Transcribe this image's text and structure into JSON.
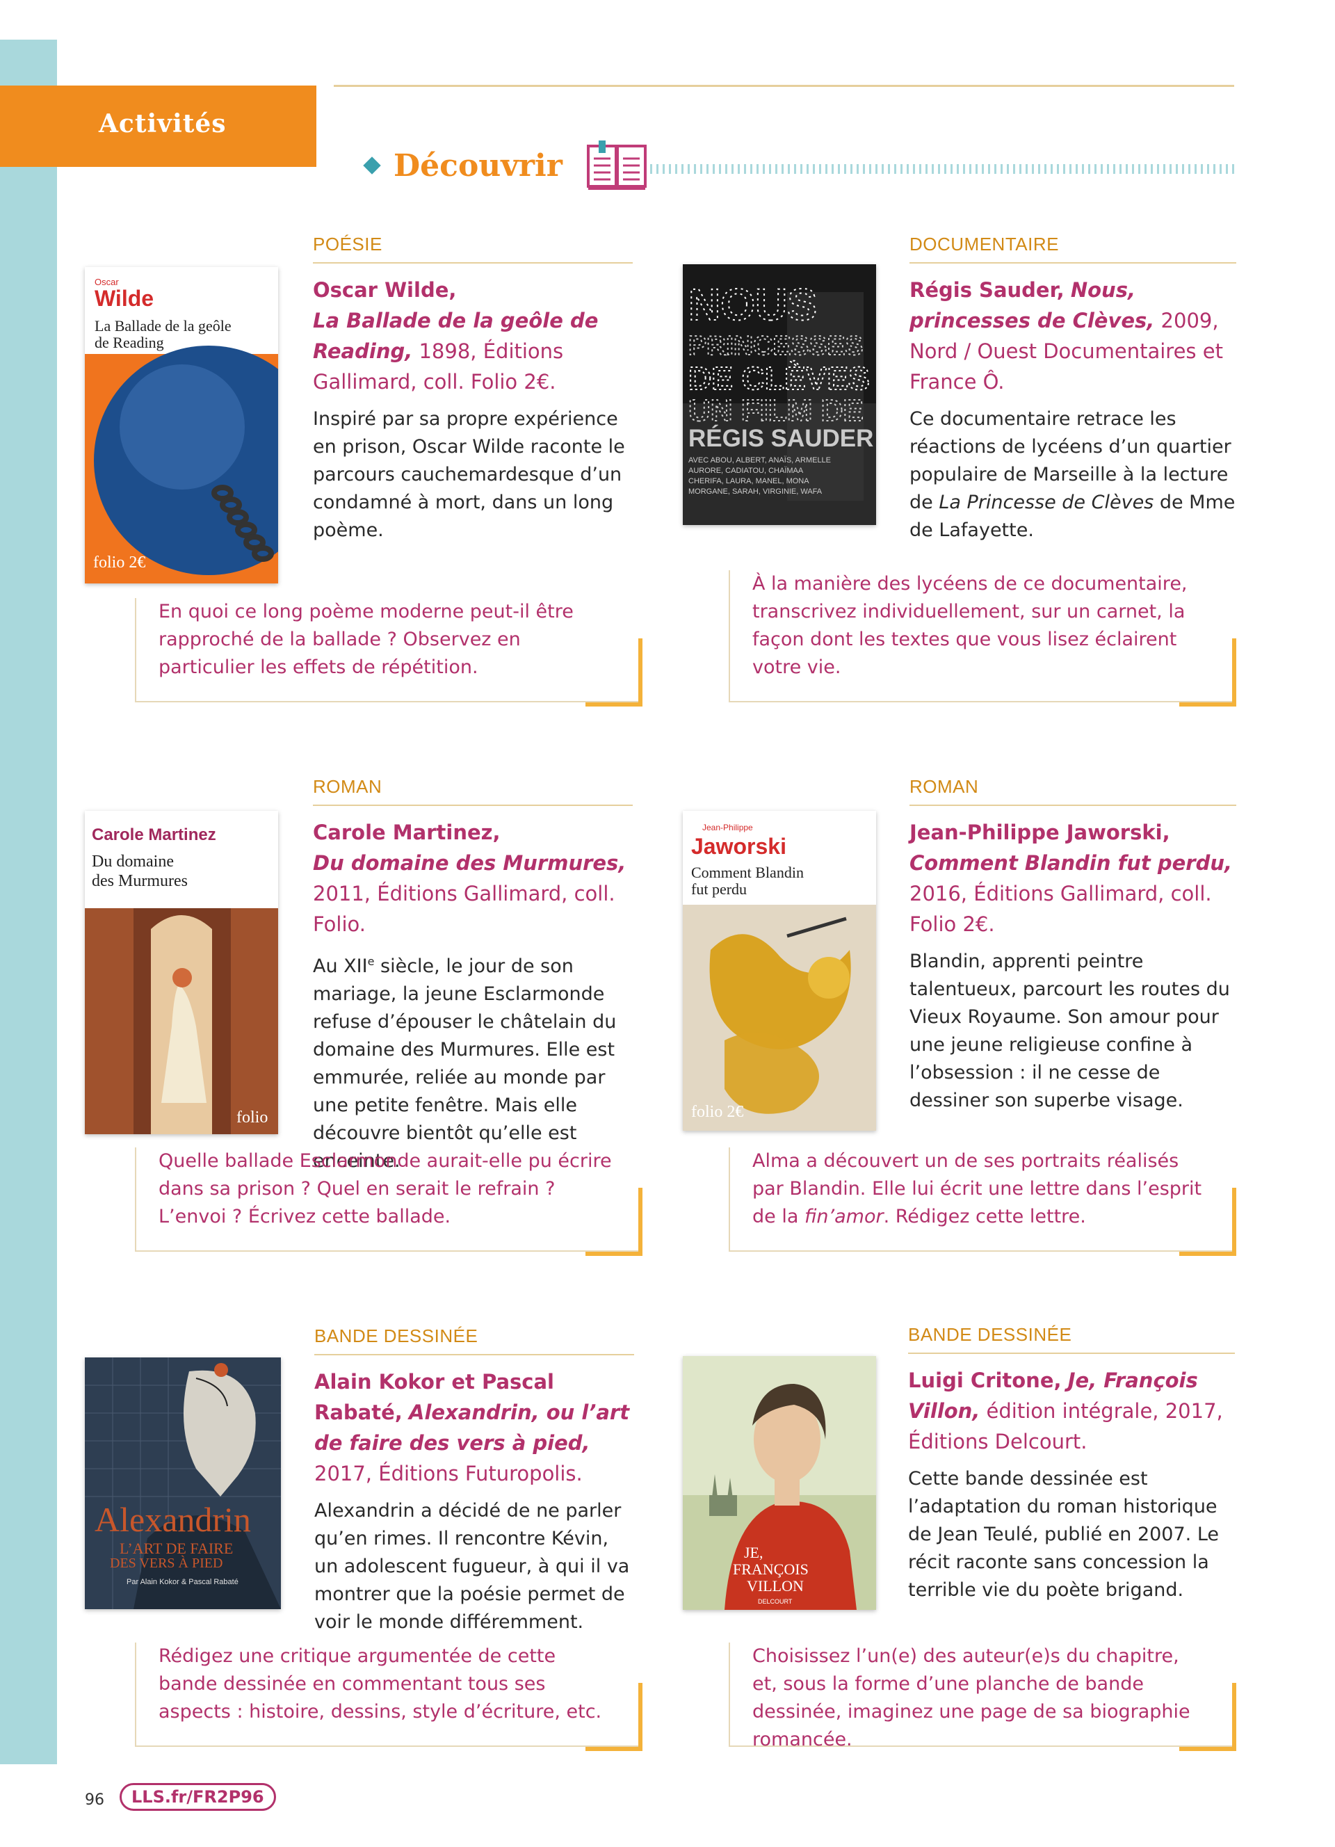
{
  "header": {
    "tab_label": "Activités",
    "section_title": "Découvrir"
  },
  "works": [
    {
      "category": "POÉSIE",
      "author": "Oscar Wilde,",
      "title": "La Ballade de la geôle de Reading,",
      "details": " 1898, Éditions Gallimard, coll. Folio 2€.",
      "description": "Inspiré par sa propre expérience en prison, Oscar Wilde raconte le parcours cauchemardesque d’un condamné à mort, dans un long poème.",
      "question": "En quoi ce long poème moderne peut-il être rapproché de la ballade ? Observez en particulier les effets de répétition.",
      "cover": {
        "small": "Oscar",
        "author": "Wilde",
        "title": "La Ballade de la geôle de Reading",
        "imprint": "folio 2€"
      }
    },
    {
      "category": "DOCUMENTAIRE",
      "author": "Régis Sauder,",
      "title": "Nous, princesses de Clèves,",
      "details": " 2009, Nord / Ouest Documentaires et France Ô.",
      "desc_pre": "Ce documentaire retrace les réactions de lycéens d’un quartier populaire de Marseille à la lecture de ",
      "desc_italic": "La Princesse de Clèves",
      "desc_post": " de Mme de Lafayette.",
      "question": "À la manière des lycéens de ce documentaire, transcrivez individuellement, sur un carnet, la façon dont les textes que vous lisez éclairent votre vie.",
      "cover": {
        "line1": "NOUS",
        "line2": "PRINCESSES",
        "line3": "DE CLÈVES",
        "line4": "UN FILM DE",
        "line5": "RÉGIS SAUDER",
        "cast": "AVEC ABOU, ALBERT, ANAÏS, ARMELLE AURORE, CADIATOU, CHAÏMAA, CHERIFA, LAURA, MANEL, MONA MORGANE, SARAH, VIRGINIE, WAFA"
      }
    },
    {
      "category": "ROMAN",
      "author": "Carole Martinez,",
      "title": "Du domaine des Murmures,",
      "details": " 2011, Éditions Gallimard, coll. Folio.",
      "desc_pre": "Au XII",
      "desc_sup": "e",
      "desc_post": " siècle, le jour de son mariage, la jeune Esclarmonde refuse d’épouser le châtelain du domaine des Murmures. Elle est emmurée, reliée au monde par une petite fenêtre. Mais elle découvre bientôt qu’elle est enceinte.",
      "question": "Quelle ballade Esclarmonde aurait-elle pu écrire dans sa prison ? Quel en serait le refrain ? L’envoi ? Écrivez cette ballade.",
      "cover": {
        "author": "Carole Martinez",
        "title": "Du domaine des Murmures",
        "imprint": "folio"
      }
    },
    {
      "category": "ROMAN",
      "author": "Jean-Philippe Jaworski,",
      "title": "Comment Blandin fut perdu,",
      "details": " 2016, Éditions Gallimard, coll. Folio 2€.",
      "description": "Blandin, apprenti peintre talentueux, parcourt les routes du Vieux Royaume. Son amour pour une jeune religieuse confine à l’obsession : il ne cesse de dessiner son superbe visage.",
      "q_pre": "Alma a découvert un de ses portraits réalisés par Blandin. Elle lui écrit une lettre dans l’esprit de la ",
      "q_italic": "fin’amor",
      "q_post": ". Rédigez cette lettre.",
      "cover": {
        "small": "Jean-Philippe",
        "author": "Jaworski",
        "title": "Comment Blandin fut perdu",
        "imprint": "folio 2€"
      }
    },
    {
      "category": "BANDE DESSINÉE",
      "author": "Alain Kokor et Pascal Rabaté,",
      "title": "Alexandrin, ou l’art de faire des vers à pied,",
      "details": " 2017, Éditions Futuropolis.",
      "description": "Alexandrin a décidé de ne parler qu’en rimes. Il rencontre Kévin, un adolescent fugueur, à qui il va montrer que la poésie permet de voir le monde différemment.",
      "question": "Rédigez une critique argumentée de cette bande dessinée en commentant tous ses aspects : histoire, dessins, style d’écriture, etc.",
      "cover": {
        "title": "Alexandrin",
        "subtitle": "L’ART DE FAIRE DES VERS À PIED",
        "by": "Par Alain Kokor & Pascal Rabaté"
      }
    },
    {
      "category": "BANDE DESSINÉE",
      "author": "Luigi Critone,",
      "title": "Je, François Villon,",
      "details": " édition intégrale, 2017, Éditions Delcourt.",
      "description": "Cette bande dessinée est l’adaptation du roman historique de Jean Teulé, publié en 2007. Le récit raconte sans concession la terrible vie du poète brigand.",
      "question": "Choisissez l’un(e) des auteur(e)s du chapitre, et, sous la forme d’une planche de bande dessinée, imaginez une page de sa biographie romancée.",
      "cover": {
        "title": "JE, FRANÇOIS VILLON",
        "publisher": "DELCOURT"
      }
    }
  ],
  "footer": {
    "page_number": "96",
    "link": "LLS.fr/FR2P96"
  },
  "colors": {
    "orange": "#f08c1e",
    "magenta": "#b2316b",
    "teal_band": "#a9d8dc",
    "gold": "#d28a16"
  }
}
